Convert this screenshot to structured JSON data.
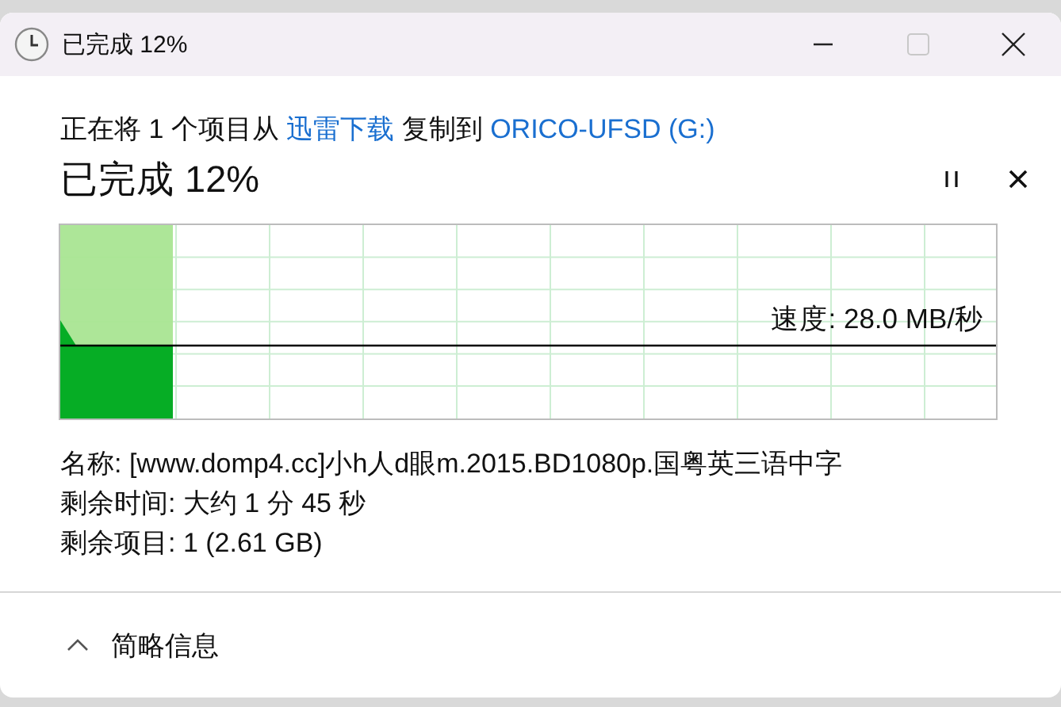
{
  "window": {
    "title": "已完成 12%"
  },
  "summary": [
    {
      "kind": "plain",
      "text": "正在将 1 个项目从 "
    },
    {
      "kind": "link",
      "text": "迅雷下载"
    },
    {
      "kind": "plain",
      "text": " 复制到 "
    },
    {
      "kind": "link",
      "text": "ORICO-UFSD (G:)"
    }
  ],
  "heading": "已完成 12%",
  "progress": {
    "level": 0.12,
    "speed": "速度: 28.0 MB/秒"
  },
  "details": [
    "名称: [www.domp4.cc]小h人d眼m.2015.BD1080p.国粤英三语中字",
    "剩余时间: 大约 1 分 45 秒",
    "剩余项目: 1 (2.61 GB)"
  ],
  "footer": {
    "label": "简略信息",
    "expanded": true
  }
}
